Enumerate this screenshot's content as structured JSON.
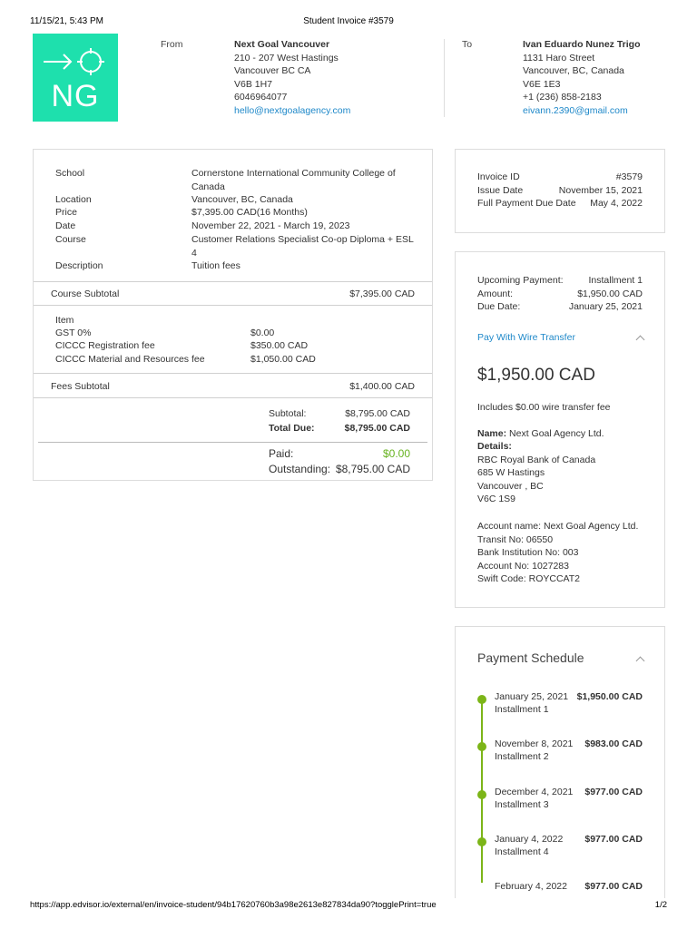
{
  "print": {
    "datetime": "11/15/21, 5:43 PM",
    "title": "Student Invoice #3579",
    "url": "https://app.edvisor.io/external/en/invoice-student/94b17620760b3a98e2613e827834da90?togglePrint=true",
    "page": "1/2"
  },
  "logo": {
    "text": "NG",
    "color": "#1ee0ad"
  },
  "from": {
    "label": "From",
    "name": "Next Goal Vancouver",
    "line1": "210 - 207 West Hastings",
    "line2": "Vancouver BC CA",
    "line3": "V6B 1H7",
    "phone": "6046964077",
    "email": "hello@nextgoalagency.com"
  },
  "to": {
    "label": "To",
    "name": "Ivan Eduardo Nunez Trigo",
    "line1": "1131 Haro Street",
    "line2": "Vancouver, BC, Canada",
    "line3": "V6E 1E3",
    "phone": "+1 (236) 858-2183",
    "email": "eivann.2390@gmail.com"
  },
  "course": {
    "school_label": "School",
    "school_value1": "Cornerstone International Community College of",
    "school_value2": "Canada",
    "location_label": "Location",
    "location_value": "Vancouver, BC, Canada",
    "price_label": "Price",
    "price_value": "$7,395.00 CAD(16 Months)",
    "date_label": "Date",
    "date_value": "November 22, 2021 - March 19, 2023",
    "course_label": "Course",
    "course_value1": "Customer Relations Specialist Co-op Diploma + ESL",
    "course_value2": "4",
    "description_label": "Description",
    "description_value": "Tuition fees",
    "subtotal_label": "Course Subtotal",
    "subtotal_value": "$7,395.00 CAD"
  },
  "fees": {
    "header": "Item",
    "items": [
      {
        "name": "GST 0%",
        "amount": "$0.00"
      },
      {
        "name": "CICCC Registration fee",
        "amount": "$350.00 CAD"
      },
      {
        "name": "CICCC Material and Resources fee",
        "amount": "$1,050.00 CAD"
      }
    ],
    "subtotal_label": "Fees Subtotal",
    "subtotal_value": "$1,400.00 CAD"
  },
  "totals": {
    "subtotal_label": "Subtotal:",
    "subtotal_value": "$8,795.00 CAD",
    "total_label": "Total Due:",
    "total_value": "$8,795.00 CAD",
    "paid_label": "Paid:",
    "paid_value": "$0.00",
    "outstanding_label": "Outstanding:",
    "outstanding_value": "$8,795.00 CAD"
  },
  "invoice_info": {
    "id_label": "Invoice ID",
    "id_value": "#3579",
    "issue_label": "Issue Date",
    "issue_value": "November 15, 2021",
    "due_label": "Full Payment Due Date",
    "due_value": "May 4, 2022"
  },
  "upcoming": {
    "upcoming_label": "Upcoming Payment:",
    "upcoming_value": "Installment 1",
    "amount_label": "Amount:",
    "amount_value": "$1,950.00 CAD",
    "due_label": "Due Date:",
    "due_value": "January 25, 2021",
    "pay_link": "Pay With Wire Transfer",
    "big_amount": "$1,950.00 CAD",
    "fee_note": "Includes $0.00 wire transfer fee",
    "name_label": "Name:",
    "name_value": "Next Goal Agency Ltd.",
    "details_label": "Details:",
    "bank1": "RBC Royal Bank of Canada",
    "bank2": "685 W Hastings",
    "bank3": "Vancouver , BC",
    "bank4": "V6C 1S9",
    "account_name": "Account name: Next Goal Agency Ltd.",
    "transit": "Transit No: 06550",
    "institution": "Bank Institution No: 003",
    "account_no": "Account No: 1027283",
    "swift": "Swift Code: ROYCCAT2"
  },
  "schedule": {
    "title": "Payment Schedule",
    "items": [
      {
        "date": "January 25, 2021",
        "label": "Installment 1",
        "amount": "$1,950.00 CAD"
      },
      {
        "date": "November 8, 2021",
        "label": "Installment 2",
        "amount": "$983.00 CAD"
      },
      {
        "date": "December 4, 2021",
        "label": "Installment 3",
        "amount": "$977.00 CAD"
      },
      {
        "date": "January 4, 2022",
        "label": "Installment 4",
        "amount": "$977.00 CAD"
      },
      {
        "date": "February 4, 2022",
        "label": "",
        "amount": "$977.00 CAD"
      }
    ]
  }
}
